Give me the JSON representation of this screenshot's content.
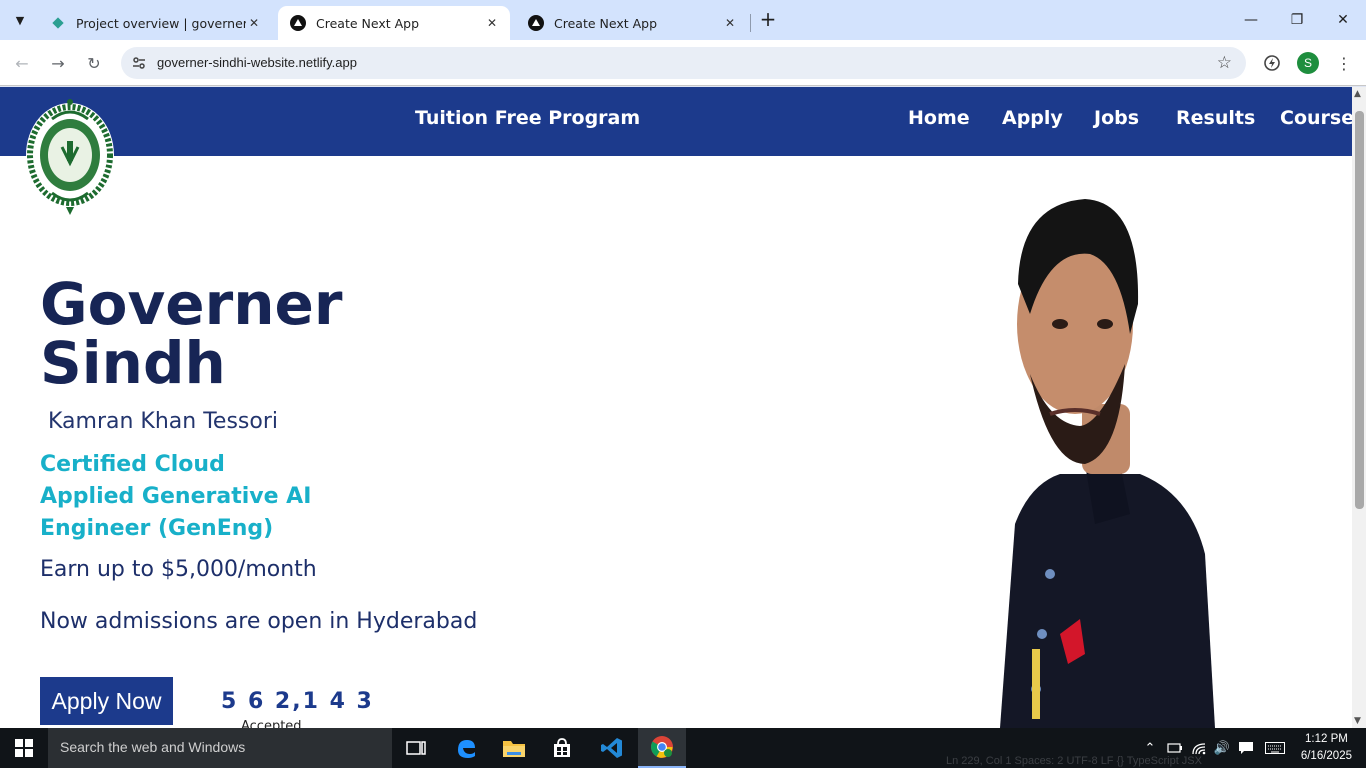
{
  "browser": {
    "tabs": [
      {
        "title": "Project overview | governer-sindhi",
        "active": false
      },
      {
        "title": "Create Next App",
        "active": true
      },
      {
        "title": "Create Next App",
        "active": false
      }
    ],
    "url": "governer-sindhi-website.netlify.app",
    "profile_initial": "S"
  },
  "site": {
    "nav": {
      "brand": "Tuition Free Program",
      "links": [
        "Home",
        "Apply",
        "Jobs",
        "Results",
        "Courses"
      ]
    },
    "hero": {
      "title_line1": "Governer",
      "title_line2": "Sindh",
      "subtitle": "Kamran Khan Tessori",
      "cert_line1": "Certified Cloud",
      "cert_line2": "Applied Generative AI",
      "cert_line3": "Engineer (GenEng)",
      "earn": "Earn up to $5,000/month",
      "admissions": "Now admissions are open in Hyderabad",
      "apply_button": "Apply Now",
      "counter_value": "5 6 2,1 4 3",
      "counter_label": "Accepted"
    }
  },
  "taskbar": {
    "search_placeholder": "Search the web and Windows",
    "time": "1:12 PM",
    "date": "6/16/2025",
    "background_status": "Ln 229, Col 1   Spaces: 2   UTF-8   LF   {} TypeScript JSX"
  },
  "colors": {
    "navbar": "#1c3a8c",
    "title": "#172555",
    "accent_teal": "#18b0c9",
    "tabstrip": "#d3e3fd"
  }
}
